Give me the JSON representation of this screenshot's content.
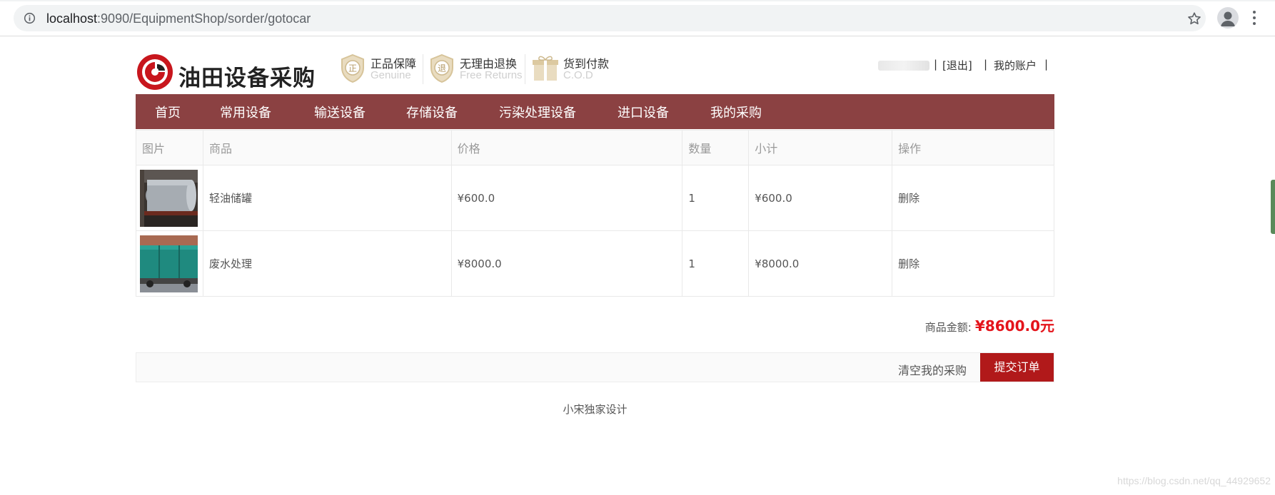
{
  "browser": {
    "url_host": "localhost",
    "url_rest": ":9090/EquipmentShop/sorder/gotocar"
  },
  "brand": {
    "name": "油田设备采购",
    "badges": [
      {
        "title": "正品保障",
        "sub": "Genuine",
        "icon_char": "正"
      },
      {
        "title": "无理由退换",
        "sub": "Free Returns",
        "icon_char": "退"
      },
      {
        "title": "货到付款",
        "sub": "C.O.D",
        "icon_char": "礼"
      }
    ]
  },
  "userbar": {
    "logout": "[退出]",
    "sep": "|",
    "account": "我的账户"
  },
  "nav": {
    "items": [
      "首页",
      "常用设备",
      "输送设备",
      "存储设备",
      "污染处理设备",
      "进口设备",
      "我的采购"
    ]
  },
  "cart": {
    "headers": [
      "图片",
      "商品",
      "价格",
      "数量",
      "小计",
      "操作"
    ],
    "rows": [
      {
        "name": "轻油储罐",
        "price": "¥600.0",
        "qty": "1",
        "subtotal": "¥600.0",
        "action": "删除"
      },
      {
        "name": "废水处理",
        "price": "¥8000.0",
        "qty": "1",
        "subtotal": "¥8000.0",
        "action": "删除"
      }
    ]
  },
  "summary": {
    "label": "商品金额:",
    "amount": "¥8600.0元"
  },
  "actions": {
    "clear": "清空我的采购",
    "submit": "提交订单"
  },
  "footer": "小宋独家设计",
  "watermark": "https://blog.csdn.net/qq_44929652",
  "colors": {
    "nav_bg": "#8b4142",
    "submit_bg": "#b1191a",
    "total_red": "#e4141b"
  }
}
